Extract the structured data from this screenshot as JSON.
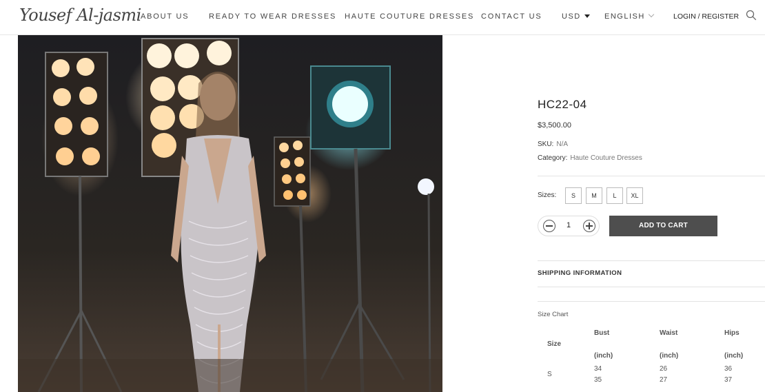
{
  "header": {
    "logo": "Yousef Al-jasmi",
    "nav": [
      "ABOUT US",
      "READY TO WEAR DRESSES",
      "HAUTE COUTURE DRESSES",
      "CONTACT US"
    ],
    "currency": "USD",
    "language": "ENGLISH",
    "login": "LOGIN / REGISTER"
  },
  "product": {
    "title": "HC22-04",
    "price": "$3,500.00",
    "sku_label": "SKU:",
    "sku_value": "N/A",
    "category_label": "Category:",
    "category_value": "Haute Couture Dresses",
    "sizes_label": "Sizes:",
    "sizes": [
      "S",
      "M",
      "L",
      "XL"
    ],
    "quantity": "1",
    "add_to_cart": "ADD TO CART",
    "shipping": "SHIPPING INFORMATION"
  },
  "size_chart": {
    "title": "Size Chart",
    "row_header": "Size",
    "columns": [
      "Bust",
      "Waist",
      "Hips"
    ],
    "unit": "(inch)",
    "row_label": "S",
    "rows": [
      [
        "34",
        "26",
        "36"
      ],
      [
        "35",
        "27",
        "37"
      ]
    ]
  },
  "icons": {
    "search": "search-icon",
    "caret": "caret-down-icon",
    "chevron": "chevron-down-icon"
  }
}
